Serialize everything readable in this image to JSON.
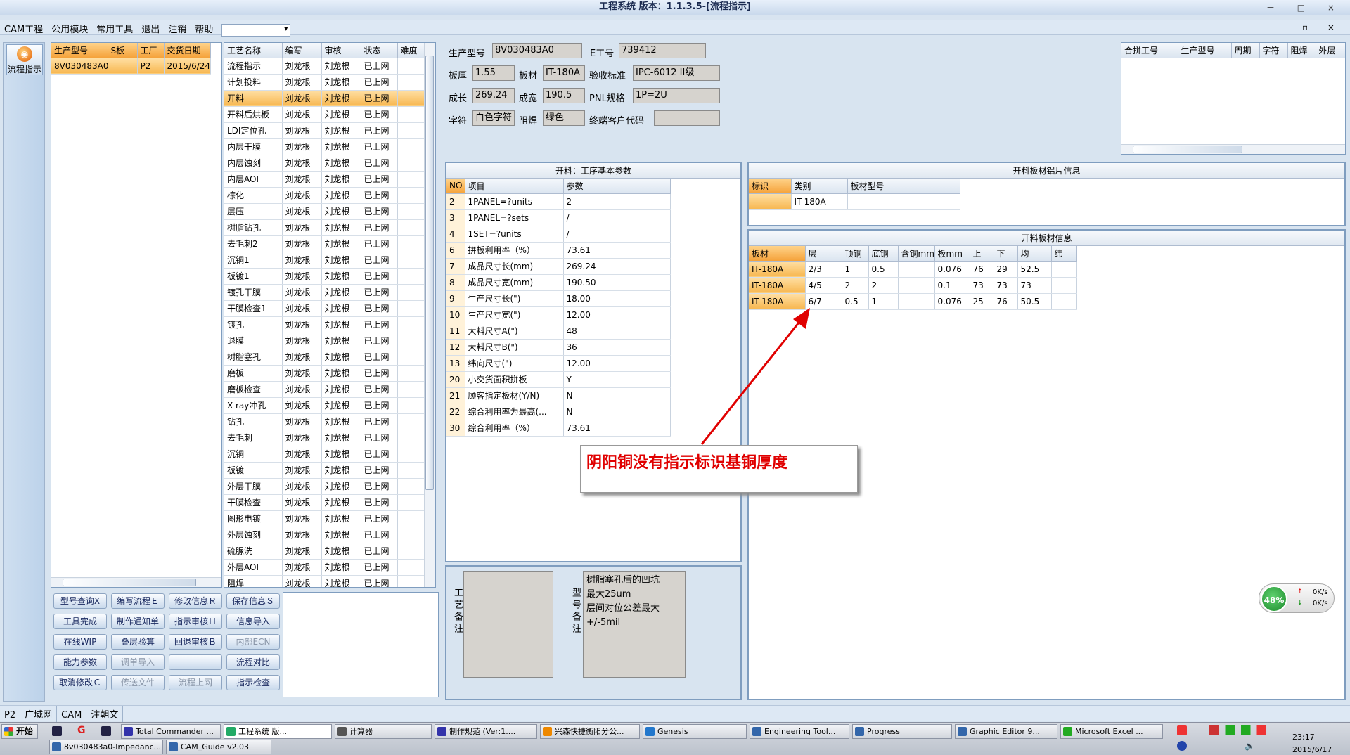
{
  "window": {
    "title": "工程系统 版本：1.1.3.5-[流程指示]",
    "controls": "－ □ ×",
    "mdi_controls": "_ ▫ ×"
  },
  "menu": [
    "CAM工程",
    "公用模块",
    "常用工具",
    "退出",
    "注销",
    "帮助"
  ],
  "menu_combo": "",
  "left_toolbar": {
    "button_label": "流程指示"
  },
  "jobs": {
    "columns": [
      "生产型号",
      "S板",
      "工厂",
      "交货日期"
    ],
    "rows": [
      [
        "8V030483A0",
        "",
        "P2",
        "2015/6/24"
      ]
    ]
  },
  "processes": {
    "columns": [
      "工艺名称",
      "编写",
      "审核",
      "状态",
      "难度"
    ],
    "rows": [
      [
        "流程指示",
        "刘龙根",
        "刘龙根",
        "已上网",
        ""
      ],
      [
        "计划投料",
        "刘龙根",
        "刘龙根",
        "已上网",
        ""
      ],
      [
        "开料",
        "刘龙根",
        "刘龙根",
        "已上网",
        ""
      ],
      [
        "开料后烘板",
        "刘龙根",
        "刘龙根",
        "已上网",
        ""
      ],
      [
        "LDI定位孔",
        "刘龙根",
        "刘龙根",
        "已上网",
        ""
      ],
      [
        "内层干膜",
        "刘龙根",
        "刘龙根",
        "已上网",
        ""
      ],
      [
        "内层蚀刻",
        "刘龙根",
        "刘龙根",
        "已上网",
        ""
      ],
      [
        "内层AOI",
        "刘龙根",
        "刘龙根",
        "已上网",
        ""
      ],
      [
        "棕化",
        "刘龙根",
        "刘龙根",
        "已上网",
        ""
      ],
      [
        "层压",
        "刘龙根",
        "刘龙根",
        "已上网",
        ""
      ],
      [
        "树脂钻孔",
        "刘龙根",
        "刘龙根",
        "已上网",
        ""
      ],
      [
        "去毛刺2",
        "刘龙根",
        "刘龙根",
        "已上网",
        ""
      ],
      [
        "沉铜1",
        "刘龙根",
        "刘龙根",
        "已上网",
        ""
      ],
      [
        "板镀1",
        "刘龙根",
        "刘龙根",
        "已上网",
        ""
      ],
      [
        "镀孔干膜",
        "刘龙根",
        "刘龙根",
        "已上网",
        ""
      ],
      [
        "干膜检查1",
        "刘龙根",
        "刘龙根",
        "已上网",
        ""
      ],
      [
        "镀孔",
        "刘龙根",
        "刘龙根",
        "已上网",
        ""
      ],
      [
        "退膜",
        "刘龙根",
        "刘龙根",
        "已上网",
        ""
      ],
      [
        "树脂塞孔",
        "刘龙根",
        "刘龙根",
        "已上网",
        ""
      ],
      [
        "磨板",
        "刘龙根",
        "刘龙根",
        "已上网",
        ""
      ],
      [
        "磨板检查",
        "刘龙根",
        "刘龙根",
        "已上网",
        ""
      ],
      [
        "X-ray冲孔",
        "刘龙根",
        "刘龙根",
        "已上网",
        ""
      ],
      [
        "钻孔",
        "刘龙根",
        "刘龙根",
        "已上网",
        ""
      ],
      [
        "去毛刺",
        "刘龙根",
        "刘龙根",
        "已上网",
        ""
      ],
      [
        "沉铜",
        "刘龙根",
        "刘龙根",
        "已上网",
        ""
      ],
      [
        "板镀",
        "刘龙根",
        "刘龙根",
        "已上网",
        ""
      ],
      [
        "外层干膜",
        "刘龙根",
        "刘龙根",
        "已上网",
        ""
      ],
      [
        "干膜检查",
        "刘龙根",
        "刘龙根",
        "已上网",
        ""
      ],
      [
        "图形电镀",
        "刘龙根",
        "刘龙根",
        "已上网",
        ""
      ],
      [
        "外层蚀刻",
        "刘龙根",
        "刘龙根",
        "已上网",
        ""
      ],
      [
        "硫脲洗",
        "刘龙根",
        "刘龙根",
        "已上网",
        ""
      ],
      [
        "外层AOI",
        "刘龙根",
        "刘龙根",
        "已上网",
        ""
      ],
      [
        "阻焊",
        "刘龙根",
        "刘龙根",
        "已上网",
        ""
      ]
    ]
  },
  "buttons": [
    [
      "型号查询Ⅹ",
      "编写流程Ｅ",
      "修改信息Ｒ",
      "保存信息Ｓ"
    ],
    [
      "工具完成",
      "制作通知单",
      "指示审核Ｈ",
      "信息导入"
    ],
    [
      "在线WIP",
      "叠层验算",
      "回退审核Ｂ",
      "内部ECN"
    ],
    [
      "能力参数",
      "调单导入",
      "",
      "流程对比"
    ],
    [
      "取消修改Ｃ",
      "传送文件",
      "流程上网",
      "指示检查"
    ]
  ],
  "header": {
    "prod_model_label": "生产型号",
    "prod_model": "8V030483A0",
    "e_job_label": "E工号",
    "e_job": "739412",
    "thickness_label": "板厚",
    "thickness": "1.55",
    "material_label": "板材",
    "material": "IT-180A",
    "acceptance_label": "验收标准",
    "acceptance": "IPC-6012 II级",
    "length_label": "成长",
    "length": "269.24",
    "width_label": "成宽",
    "width": "190.5",
    "pnl_label": "PNL规格",
    "pnl": "1P=2U",
    "char_label": "字符",
    "char": "白色字符",
    "mask_label": "阻焊",
    "mask": "绿色",
    "customer_label": "终端客户代码",
    "customer": ""
  },
  "merge_table": {
    "columns": [
      "合拼工号",
      "生产型号",
      "周期",
      "字符",
      "阻焊",
      "外层"
    ]
  },
  "params": {
    "title": "开料：工序基本参数",
    "columns": [
      "NO",
      "项目",
      "参数"
    ],
    "rows": [
      [
        "2",
        "1PANEL=?units",
        "2"
      ],
      [
        "3",
        "1PANEL=?sets",
        "/"
      ],
      [
        "4",
        "1SET=?units",
        "/"
      ],
      [
        "6",
        "拼板利用率（%）",
        "73.61"
      ],
      [
        "7",
        "成品尺寸长(mm)",
        "269.24"
      ],
      [
        "8",
        "成品尺寸宽(mm)",
        "190.50"
      ],
      [
        "9",
        "生产尺寸长(\")",
        "18.00"
      ],
      [
        "10",
        "生产尺寸宽(\")",
        "12.00"
      ],
      [
        "11",
        "大料尺寸A(\")",
        "48"
      ],
      [
        "12",
        "大料尺寸B(\")",
        "36"
      ],
      [
        "13",
        "纬向尺寸(\")",
        "12.00"
      ],
      [
        "20",
        "小交货面积拼板",
        "Y"
      ],
      [
        "21",
        "顾客指定板材(Y/N)",
        "N"
      ],
      [
        "22",
        "综合利用率为最高(...",
        "N"
      ],
      [
        "30",
        "综合利用率（%）",
        "73.61"
      ]
    ]
  },
  "notes": {
    "process_label": "工艺备注",
    "process_text": "",
    "model_label": "型号备注",
    "model_text": [
      "树脂塞孔后的凹坑",
      "最大25um",
      "层间对位公差最大",
      "+/-5mil"
    ]
  },
  "sheet_info": {
    "title": "开料板材铝片信息",
    "columns": [
      "标识",
      "类别",
      "板材型号"
    ],
    "rows": [
      [
        "",
        "IT-180A",
        ""
      ]
    ]
  },
  "board_info": {
    "title": "开料板材信息",
    "columns": [
      "板材",
      "层",
      "顶铜",
      "底铜",
      "含铜mm",
      "板mm",
      "上",
      "下",
      "均",
      "纬"
    ],
    "rows": [
      [
        "IT-180A",
        "2/3",
        "1",
        "0.5",
        "",
        "0.076",
        "76",
        "29",
        "52.5",
        ""
      ],
      [
        "IT-180A",
        "4/5",
        "2",
        "2",
        "",
        "0.1",
        "73",
        "73",
        "73",
        ""
      ],
      [
        "IT-180A",
        "6/7",
        "0.5",
        "1",
        "",
        "0.076",
        "25",
        "76",
        "50.5",
        ""
      ]
    ]
  },
  "annotation": {
    "text": "阴阳铜没有指示标识基铜厚度",
    "arrow_color": "#e00000"
  },
  "status_bar": [
    "P2",
    "广域网",
    "CAM",
    "注朝文"
  ],
  "net_gauge": {
    "percent": "48%",
    "up": "0K/s",
    "down": "0K/s"
  },
  "taskbar": {
    "start": "开始",
    "row1": [
      "Total Commander ...",
      "工程系统 版...",
      "计算器",
      "制作规范 (Ver:1....",
      "兴森快捷衡阳分公...",
      "Genesis",
      "Engineering Tool...",
      "Progress",
      "Graphic Editor 9...",
      "Microsoft Excel ..."
    ],
    "row2": [
      "8v030483a0-Impedanc...",
      "CAM_Guide v2.03"
    ],
    "time": "23:17",
    "date": "2015/6/17"
  }
}
